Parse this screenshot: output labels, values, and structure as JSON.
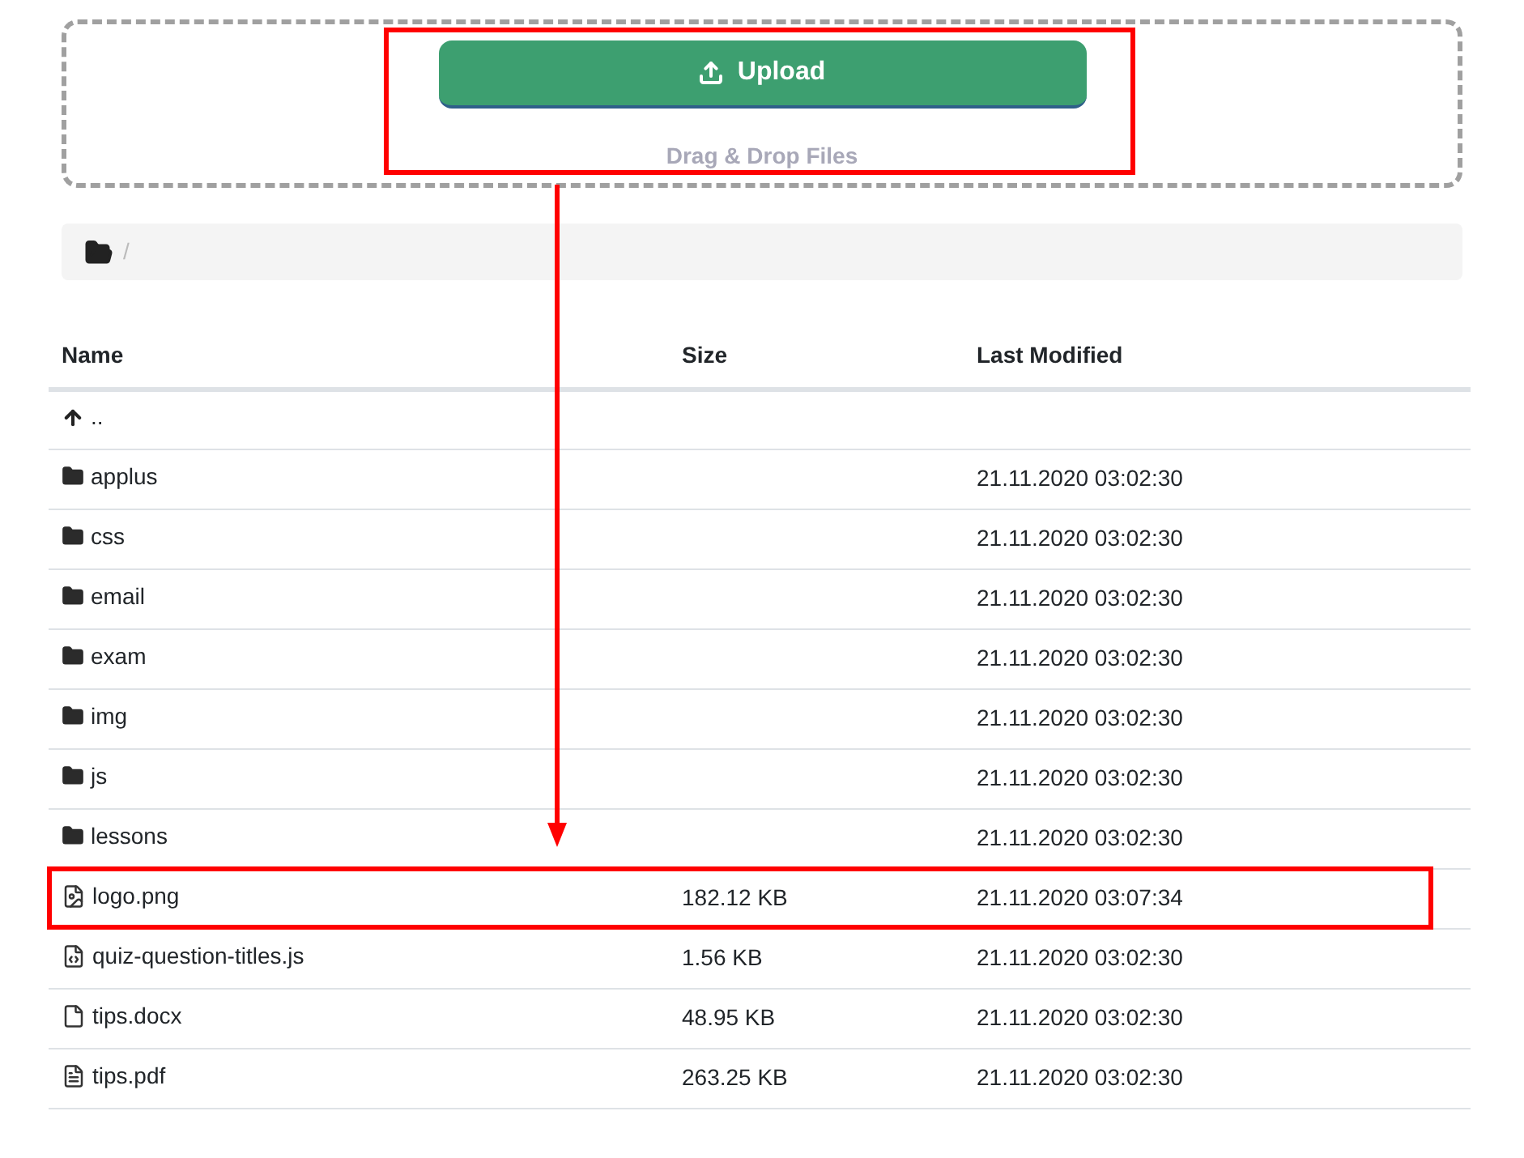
{
  "upload_button": {
    "label": "Upload"
  },
  "drop_hint": "Drag & Drop Files",
  "breadcrumb": {
    "separator": "/"
  },
  "table": {
    "columns": [
      "Name",
      "Size",
      "Last Modified"
    ],
    "rows": [
      {
        "kind": "up",
        "name": ".."
      },
      {
        "kind": "folder",
        "name": "applus",
        "modified": "21.11.2020 03:02:30"
      },
      {
        "kind": "folder",
        "name": "css",
        "modified": "21.11.2020 03:02:30"
      },
      {
        "kind": "folder",
        "name": "email",
        "modified": "21.11.2020 03:02:30"
      },
      {
        "kind": "folder",
        "name": "exam",
        "modified": "21.11.2020 03:02:30"
      },
      {
        "kind": "folder",
        "name": "img",
        "modified": "21.11.2020 03:02:30"
      },
      {
        "kind": "folder",
        "name": "js",
        "modified": "21.11.2020 03:02:30"
      },
      {
        "kind": "folder",
        "name": "lessons",
        "modified": "21.11.2020 03:02:30"
      },
      {
        "kind": "image",
        "name": "logo.png",
        "size": "182.12 KB",
        "modified": "21.11.2020 03:07:34"
      },
      {
        "kind": "code",
        "name": "quiz-question-titles.js",
        "size": "1.56 KB",
        "modified": "21.11.2020 03:02:30"
      },
      {
        "kind": "document",
        "name": "tips.docx",
        "size": "48.95 KB",
        "modified": "21.11.2020 03:02:30"
      },
      {
        "kind": "pdf",
        "name": "tips.pdf",
        "size": "263.25 KB",
        "modified": "21.11.2020 03:02:30"
      }
    ]
  }
}
